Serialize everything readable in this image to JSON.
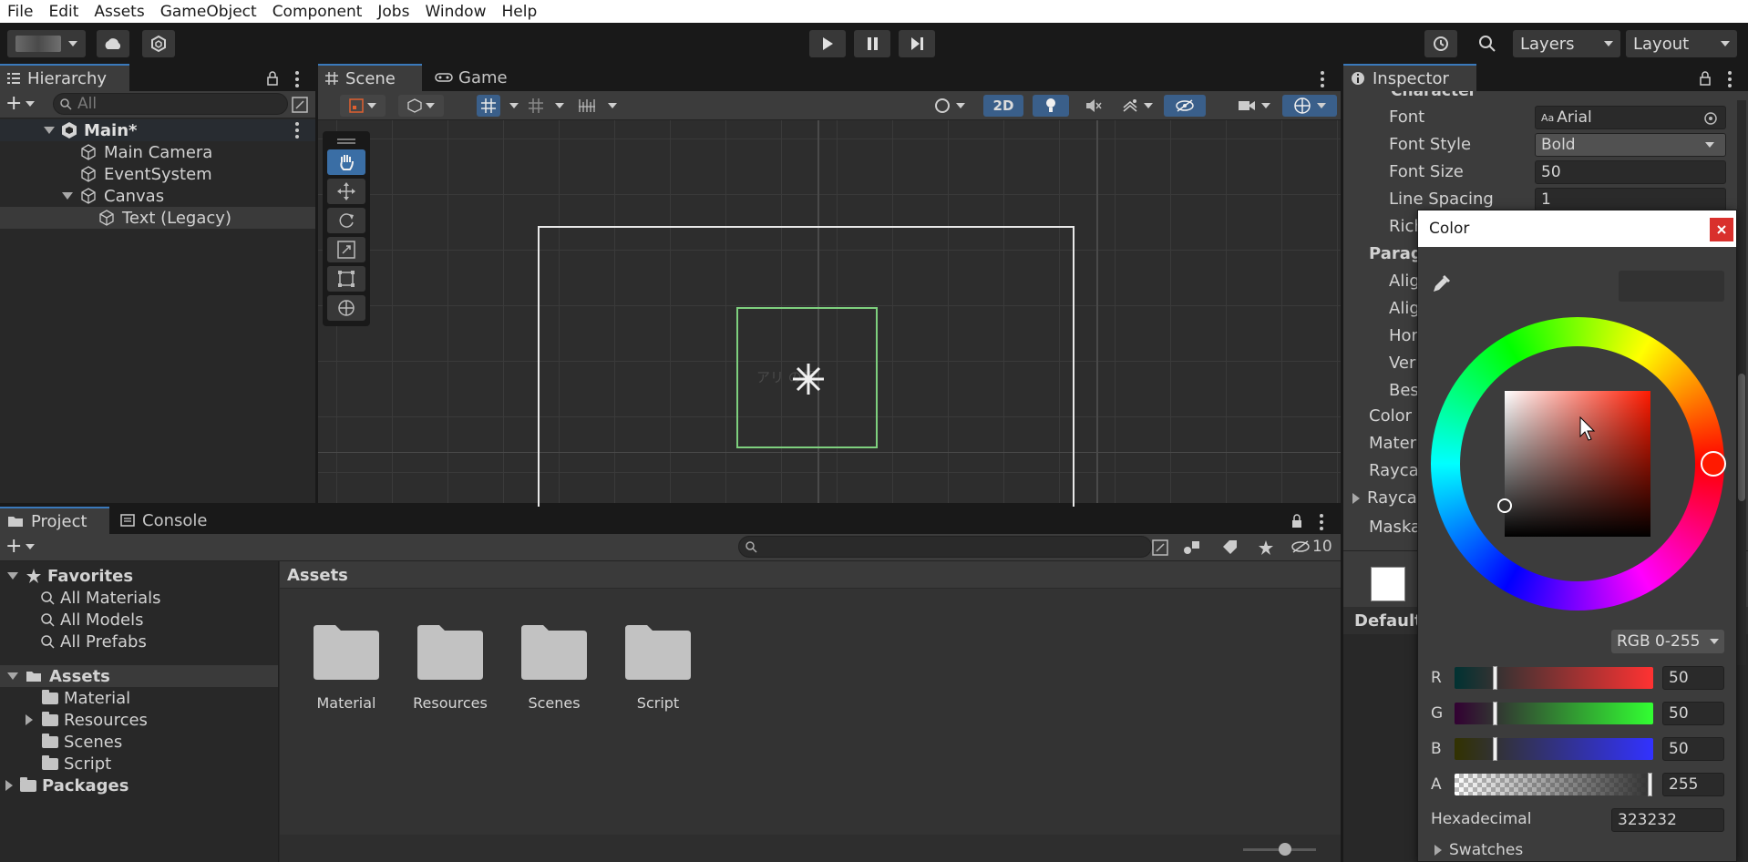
{
  "menu": [
    "File",
    "Edit",
    "Assets",
    "GameObject",
    "Component",
    "Jobs",
    "Window",
    "Help"
  ],
  "toolbar": {
    "layers_label": "Layers",
    "layout_label": "Layout"
  },
  "hierarchy": {
    "tab_label": "Hierarchy",
    "search_placeholder": "All",
    "scene_name": "Main*",
    "items": [
      "Main Camera",
      "EventSystem",
      "Canvas",
      "Text (Legacy)"
    ]
  },
  "scene_view": {
    "tabs": [
      "Scene",
      "Game"
    ],
    "mode_2d": "2D",
    "text_preview": "アリ の朝"
  },
  "project": {
    "tabs": [
      "Project",
      "Console"
    ],
    "hidden_count": "10",
    "favorites_label": "Favorites",
    "favorites": [
      "All Materials",
      "All Models",
      "All Prefabs"
    ],
    "assets_label": "Assets",
    "asset_folders": [
      "Material",
      "Resources",
      "Scenes",
      "Script"
    ],
    "packages_label": "Packages",
    "breadcrumb": "Assets",
    "grid_folders": [
      "Material",
      "Resources",
      "Scenes",
      "Script"
    ],
    "zoom_level": 0.55
  },
  "inspector": {
    "tab_label": "Inspector",
    "section_partial": "Character",
    "font_label": "Font",
    "font_value": "Arial",
    "font_value_prefix": "Aa",
    "font_style_label": "Font Style",
    "font_style_value": "Bold",
    "font_size_label": "Font Size",
    "font_size_value": "50",
    "line_spacing_label": "Line Spacing",
    "line_spacing_value": "1",
    "partial_labels": [
      "Rich",
      "Parag",
      "Alig",
      "Alig",
      "Hor",
      "Ver",
      "Bes",
      "Color",
      "Materi",
      "Rayca",
      "Rayca",
      "Maska"
    ],
    "default_label": "Default"
  },
  "color_picker": {
    "title": "Color",
    "mode": "RGB 0-255",
    "channels": [
      {
        "label": "R",
        "value": "50"
      },
      {
        "label": "G",
        "value": "50"
      },
      {
        "label": "B",
        "value": "50"
      },
      {
        "label": "A",
        "value": "255"
      }
    ],
    "hex_label": "Hexadecimal",
    "hex_value": "323232",
    "swatches_label": "Swatches",
    "colors": {
      "current": "#323232",
      "hue_marker": "#ff1a00"
    }
  }
}
